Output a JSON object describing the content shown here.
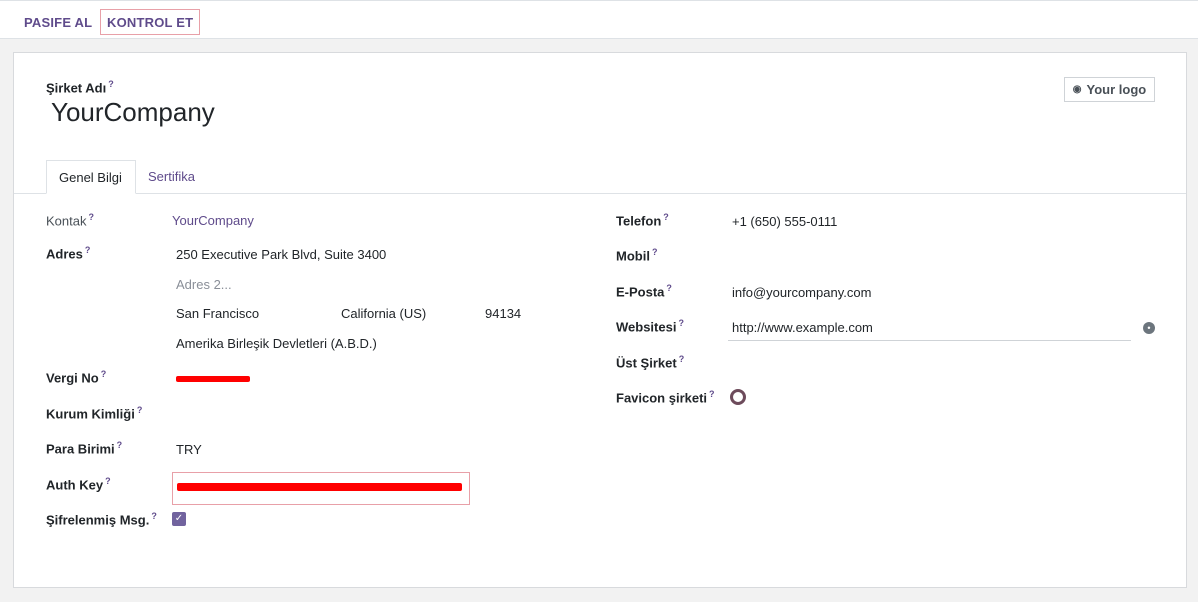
{
  "toolbar": {
    "pasife_label": "PASIFE AL",
    "kontrol_label": "KONTROL ET"
  },
  "company": {
    "name_label": "Şirket Adı",
    "name_value": "YourCompany",
    "logo_button": "Your logo",
    "help_mark": "?"
  },
  "tabs": [
    {
      "label": "Genel Bilgi"
    },
    {
      "label": "Sertifika"
    }
  ],
  "left": {
    "kontak_label": "Kontak",
    "kontak_value": "YourCompany",
    "adres_label": "Adres",
    "street": "250 Executive Park Blvd, Suite 3400",
    "street2_placeholder": "Adres 2...",
    "city": "San Francisco",
    "state": "California (US)",
    "zip": "94134",
    "country": "Amerika Birleşik Devletleri (A.B.D.)",
    "vergi_label": "Vergi No",
    "kurum_label": "Kurum Kimliği",
    "para_label": "Para Birimi",
    "para_value": "TRY",
    "auth_label": "Auth Key",
    "sifre_label": "Şifrelenmiş Msg.",
    "sifre_checked": true
  },
  "right": {
    "telefon_label": "Telefon",
    "telefon_value": "+1 (650) 555-0111",
    "mobil_label": "Mobil",
    "eposta_label": "E-Posta",
    "eposta_value": "info@yourcompany.com",
    "website_label": "Websitesi",
    "website_value": "http://www.example.com",
    "ust_label": "Üst Şirket",
    "favicon_label": "Favicon şirketi"
  },
  "colors": {
    "accent": "#5f4b8b",
    "redaction": "#ff0000",
    "highlight_border": "#e8a0a8",
    "checkbox": "#71639e"
  }
}
